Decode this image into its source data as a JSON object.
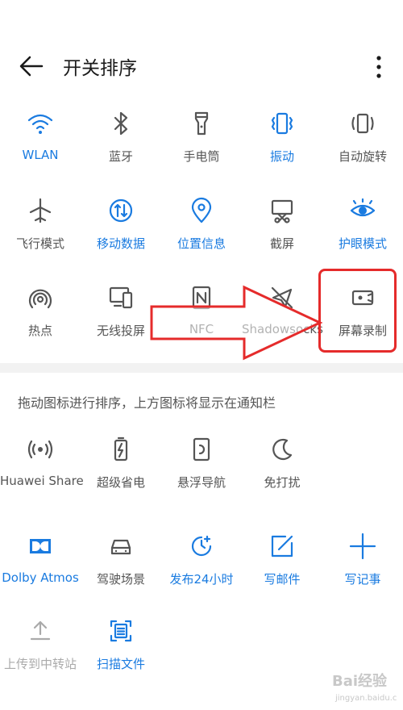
{
  "header": {
    "title": "开关排序"
  },
  "top_tiles": [
    {
      "label": "WLAN",
      "icon": "wifi-icon",
      "active": true
    },
    {
      "label": "蓝牙",
      "icon": "bluetooth-icon",
      "active": false
    },
    {
      "label": "手电筒",
      "icon": "flashlight-icon",
      "active": false
    },
    {
      "label": "振动",
      "icon": "vibrate-icon",
      "active": true
    },
    {
      "label": "自动旋转",
      "icon": "rotate-icon",
      "active": false
    },
    {
      "label": "飞行模式",
      "icon": "airplane-icon",
      "active": false
    },
    {
      "label": "移动数据",
      "icon": "mobile-data-icon",
      "active": true
    },
    {
      "label": "位置信息",
      "icon": "location-icon",
      "active": true
    },
    {
      "label": "截屏",
      "icon": "screenshot-icon",
      "active": false
    },
    {
      "label": "护眼模式",
      "icon": "eye-icon",
      "active": true
    },
    {
      "label": "热点",
      "icon": "hotspot-icon",
      "active": false
    },
    {
      "label": "无线投屏",
      "icon": "wireless-projection-icon",
      "active": false
    },
    {
      "label": "NFC",
      "icon": "nfc-icon",
      "active": false
    },
    {
      "label": "Shadowsocks",
      "icon": "shadowsocks-icon",
      "active": false
    },
    {
      "label": "屏幕录制",
      "icon": "screen-record-icon",
      "active": false
    }
  ],
  "hint": "拖动图标进行排序，上方图标将显示在通知栏",
  "bottom_tiles": [
    {
      "label": "Huawei Share",
      "icon": "huawei-share-icon",
      "style": "gray"
    },
    {
      "label": "超级省电",
      "icon": "battery-saver-icon",
      "style": "gray"
    },
    {
      "label": "悬浮导航",
      "icon": "floating-nav-icon",
      "style": "gray"
    },
    {
      "label": "免打扰",
      "icon": "moon-icon",
      "style": "gray"
    },
    {
      "label": "Dolby Atmos",
      "icon": "dolby-icon",
      "style": "blue"
    },
    {
      "label": "驾驶场景",
      "icon": "car-icon",
      "style": "gray"
    },
    {
      "label": "发布24小时",
      "icon": "publish-24h-icon",
      "style": "blue"
    },
    {
      "label": "写邮件",
      "icon": "compose-email-icon",
      "style": "blue"
    },
    {
      "label": "写记事",
      "icon": "plus-icon",
      "style": "blue"
    },
    {
      "label": "上传到中转站",
      "icon": "upload-icon",
      "style": "light"
    },
    {
      "label": "扫描文件",
      "icon": "scan-document-icon",
      "style": "blue"
    }
  ],
  "colors": {
    "active": "#1a7be0",
    "inactive": "#555555",
    "highlight": "#e52b2b"
  }
}
